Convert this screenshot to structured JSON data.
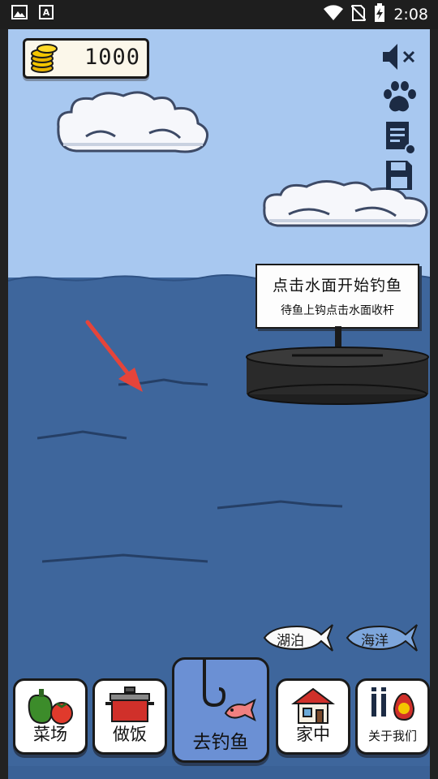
{
  "status_bar": {
    "time": "2:08",
    "icons": [
      "gallery-icon",
      "font-app-icon",
      "wifi-icon",
      "no-sim-icon",
      "battery-charging-icon"
    ]
  },
  "hud": {
    "coins": "1000",
    "coin_icon": "gold-coins-icon",
    "toolbar": [
      "mute-icon",
      "paw-icon",
      "log-icon",
      "save-icon"
    ]
  },
  "hint": {
    "title": "点击水面开始钓鱼",
    "subtitle": "待鱼上钩点击水面收杆"
  },
  "fishing_spots": [
    {
      "label": "湖泊",
      "selected": false
    },
    {
      "label": "海洋",
      "selected": true
    }
  ],
  "nav": {
    "items": [
      {
        "label": "菜场",
        "icon": "vegetables-icon"
      },
      {
        "label": "做饭",
        "icon": "cooking-pot-icon"
      },
      {
        "label": "去钓鱼",
        "icon": "fishing-hook-icon",
        "active": true
      },
      {
        "label": "家中",
        "icon": "house-icon"
      },
      {
        "label": "关于我们",
        "icon": "about-money-bag-icon"
      }
    ]
  },
  "colors": {
    "sky": "#a8c8f0",
    "sea": "#3e669c",
    "active_nav": "#6b90d4",
    "arrow": "#e5443a"
  }
}
